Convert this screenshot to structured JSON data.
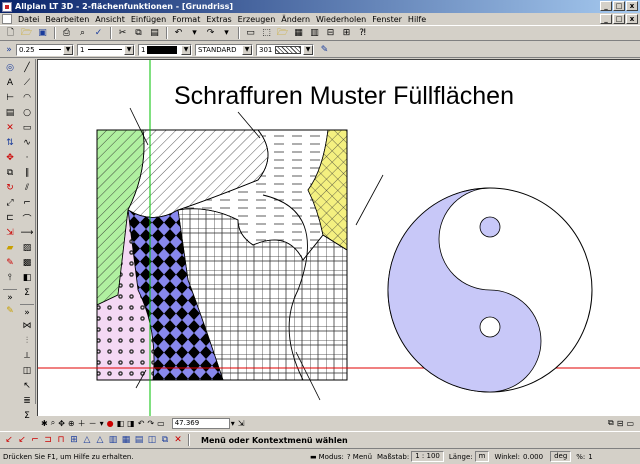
{
  "window": {
    "title": "Allplan LT 3D - 2-flächenfunktionen - [Grundriss]",
    "btn_min": "_",
    "btn_max": "□",
    "btn_close": "x",
    "mdi_min": "_",
    "mdi_max": "□",
    "mdi_close": "x"
  },
  "menu": [
    "Datei",
    "Bearbeiten",
    "Ansicht",
    "Einfügen",
    "Format",
    "Extras",
    "Erzeugen",
    "Ändern",
    "Wiederholen",
    "Fenster",
    "Hilfe"
  ],
  "format_bar": {
    "pen": "0.25",
    "line": "1",
    "color": "1",
    "layer": "STANDARD",
    "hatch": "301"
  },
  "drawing": {
    "heading": "Schraffuren Muster Füllflächen"
  },
  "canvas_bar": {
    "coordinate": "47.369"
  },
  "hint": "Menü oder Kontextmenü wählen",
  "status": {
    "help": "Drücken Sie F1, um Hilfe zu erhalten.",
    "modus_label": "Modus:",
    "modus_value": "? Menü",
    "scale_label": "Maßstab:",
    "scale_value": "1 : 100",
    "length_label": "Länge:",
    "length_value": "m",
    "angle_label": "Winkel:",
    "angle_value": "0.000",
    "unit_value": "deg",
    "percent_label": "%:",
    "percent_value": "1"
  },
  "colors": {
    "titlebar": "#0a246a",
    "hatch_blue": "#8888ee",
    "fill_green": "#b0f0a0",
    "fill_pink": "#f4d8f4",
    "fill_yellow": "#f4f080",
    "yin_yang": "#c8c8f8",
    "axis_green": "#00c000",
    "axis_red": "#e00000"
  }
}
